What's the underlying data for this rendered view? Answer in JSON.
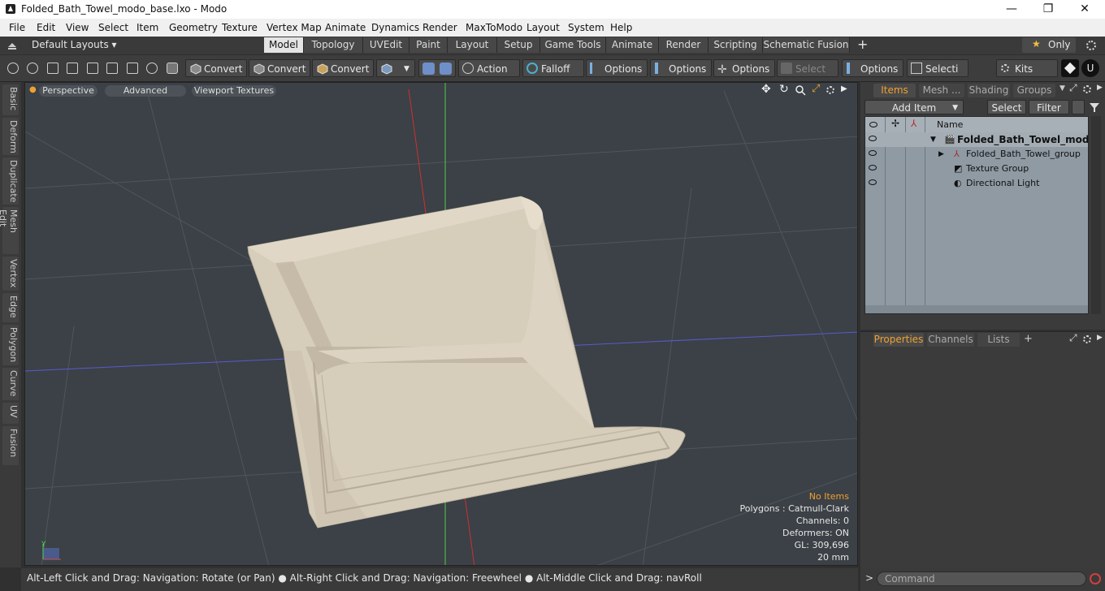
{
  "window": {
    "title": "Folded_Bath_Towel_modo_base.lxo - Modo",
    "minimize": "—",
    "maximize": "❐",
    "close": "✕"
  },
  "menu": [
    "File",
    "Edit",
    "View",
    "Select",
    "Item",
    "Geometry",
    "Texture",
    "Vertex Map",
    "Animate",
    "Dynamics",
    "Render",
    "MaxToModo",
    "Layout",
    "System",
    "Help"
  ],
  "layoutbar": {
    "layouts_label": "Default Layouts ▾",
    "tabs": [
      "Model",
      "Topology",
      "UVEdit",
      "Paint",
      "Layout",
      "Setup",
      "Game Tools",
      "Animate",
      "Render",
      "Scripting",
      "Schematic Fusion"
    ],
    "active_tab": "Model",
    "add": "+",
    "only": "Only",
    "star": "★"
  },
  "toolbar": {
    "convert1": "Convert",
    "convert2": "Convert",
    "convert3": "Convert",
    "action": "Action ...",
    "falloff": "Falloff",
    "options1": "Options",
    "options2": "Options",
    "options3": "Options",
    "select_t": "Select T...",
    "options4": "Options",
    "selecti": "Selecti ...",
    "kits": "Kits"
  },
  "lefttabs": [
    "Basic",
    "Deform",
    "Duplicate",
    "Mesh Edit",
    "Vertex",
    "Edge",
    "Polygon",
    "Curve",
    "UV",
    "Fusion"
  ],
  "viewport": {
    "view_mode": "Perspective",
    "advanced": "Advanced",
    "textures": "Viewport Textures",
    "info": {
      "selection": "No Items",
      "polygons": "Polygons : Catmull-Clark",
      "channels": "Channels: 0",
      "deformers": "Deformers: ON",
      "gl": "GL: 309,696",
      "scale": "20 mm"
    },
    "axis_y": "Y"
  },
  "status": "Alt-Left Click and Drag: Navigation: Rotate (or Pan) ● Alt-Right Click and Drag: Navigation: Freewheel ● Alt-Middle Click and Drag: navRoll",
  "items_panel": {
    "tabs": [
      "Items",
      "Mesh ...",
      "Shading",
      "Groups"
    ],
    "active": "Items",
    "add_item": "Add Item",
    "select": "Select",
    "filter": "Filter",
    "name_col": "Name",
    "rows": [
      {
        "name": "Folded_Bath_Towel_modo...",
        "bold": true
      },
      {
        "name": "Folded_Bath_Towel_group",
        "bold": false
      },
      {
        "name": "Texture Group",
        "bold": false
      },
      {
        "name": "Directional Light",
        "bold": false
      }
    ]
  },
  "props_panel": {
    "tabs": [
      "Properties",
      "Channels",
      "Lists"
    ],
    "active": "Properties",
    "add": "+"
  },
  "command": {
    "placeholder": "Command",
    "prompt": ">"
  },
  "colors": {
    "accent": "#f0a030",
    "towel": "#ddd4c2",
    "viewport_bg": "#3b4146",
    "grid": "#52595f",
    "axis_x": "#d83030",
    "axis_y": "#50d050",
    "axis_z": "#5050d8"
  }
}
